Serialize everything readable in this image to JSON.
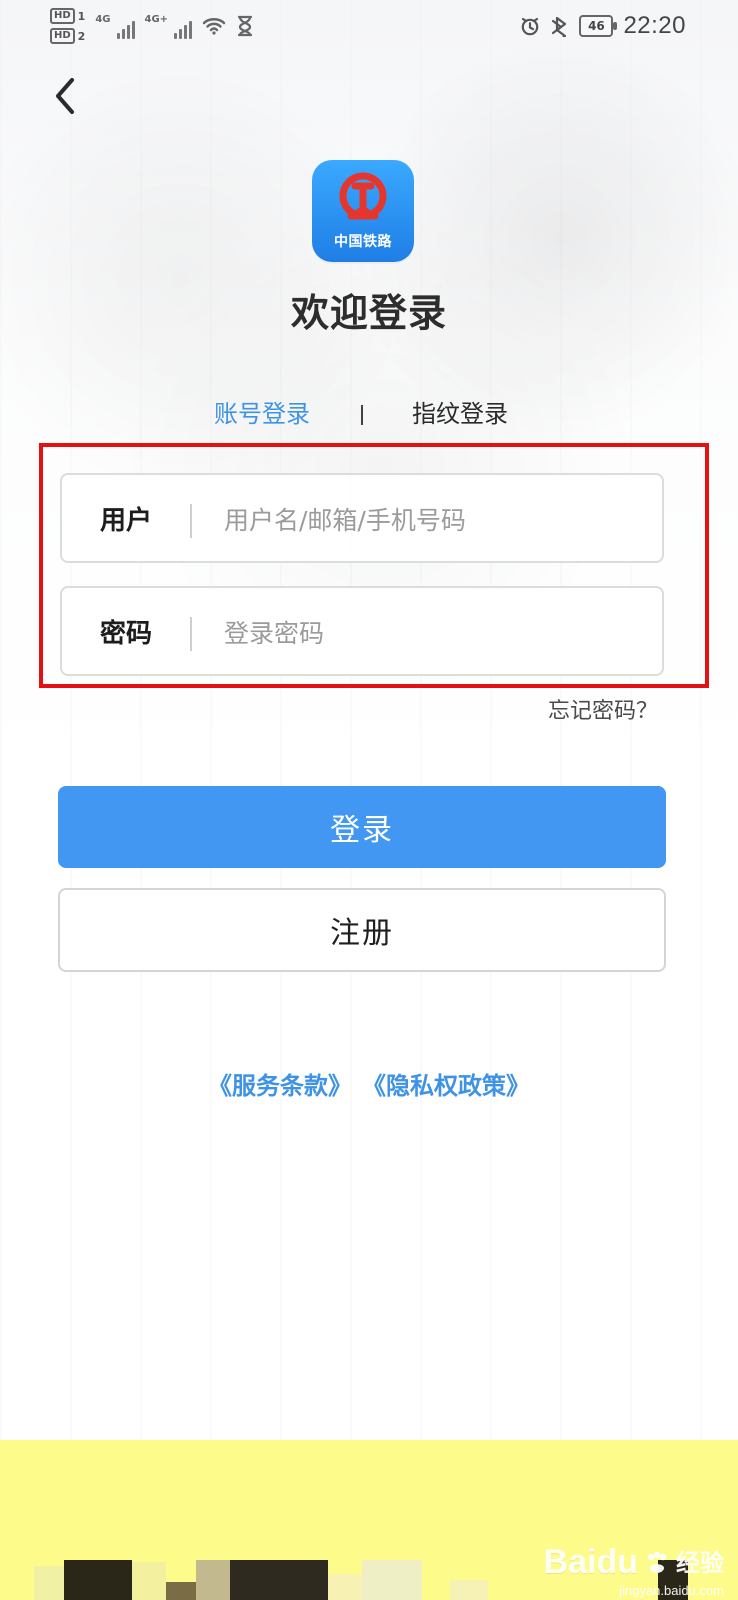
{
  "status_bar": {
    "sim1_label": "HD",
    "sim1_index": "1",
    "sim2_label": "HD",
    "sim2_index": "2",
    "network1_label": "4G",
    "network2_label": "4G+",
    "battery_level": "46",
    "time": "22:20",
    "icons": [
      "signal-icon",
      "wifi-icon",
      "hourglass-icon",
      "alarm-icon",
      "bluetooth-icon"
    ]
  },
  "header": {
    "back_icon": "chevron-left-icon"
  },
  "app": {
    "logo_text": "中国铁路",
    "logo_icon": "railway-logo-icon"
  },
  "page": {
    "title": "欢迎登录"
  },
  "login_tabs": {
    "account": "账号登录",
    "fingerprint": "指纹登录",
    "active": "账号登录"
  },
  "form": {
    "username_label": "用户",
    "username_placeholder": "用户名/邮箱/手机号码",
    "password_label": "密码",
    "password_placeholder": "登录密码",
    "forgot_password": "忘记密码？"
  },
  "actions": {
    "login_label": "登录",
    "register_label": "注册"
  },
  "legal": {
    "terms": "《服务条款》",
    "privacy": "《隐私权政策》"
  },
  "watermark": {
    "brand": "Baidu",
    "suffix": "经验",
    "url": "jingyan.baidu.com"
  },
  "colors": {
    "accent": "#4297f2",
    "link": "#3f93e6",
    "highlight_border": "#e31111",
    "logo_red": "#e5362d",
    "bottom_band": "#fdfb8a"
  }
}
